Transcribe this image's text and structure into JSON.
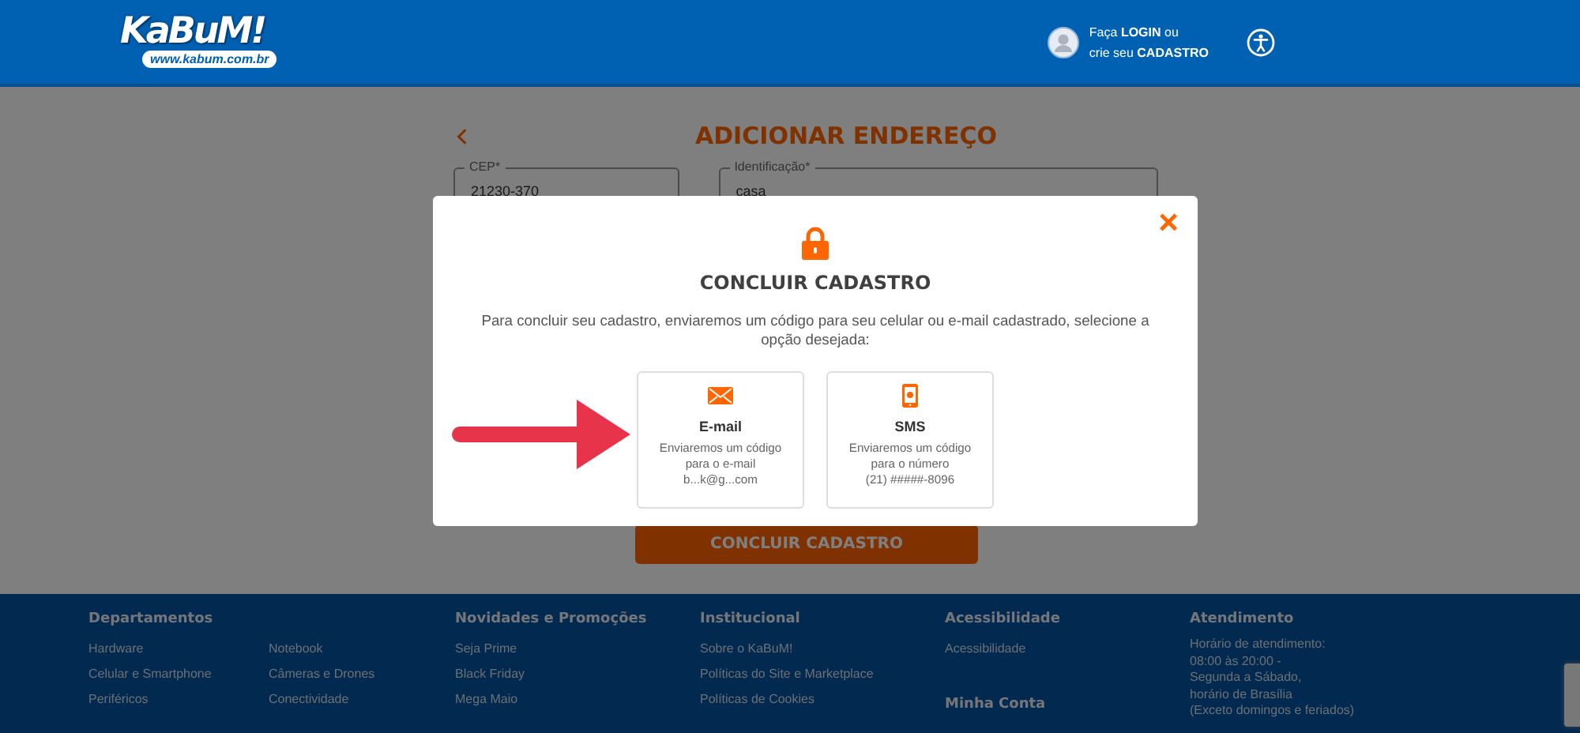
{
  "header": {
    "logo": "KaBuM!",
    "logo_url": "www.kabum.com.br",
    "login_text": [
      "Faça **LOGIN** ou",
      "crie seu **CADASTRO**"
    ]
  },
  "form": {
    "title": "ADICIONAR ENDEREÇO",
    "fields": [
      {
        "label": "CEP*",
        "value": "21230-370"
      },
      {
        "label": "Identificação*",
        "value": "casa"
      }
    ],
    "submit": "CONCLUIR CADASTRO"
  },
  "modal": {
    "title": "CONCLUIR CADASTRO",
    "close": "×",
    "description": "Para concluir seu cadastro, enviaremos um código para seu celular ou e-mail cadastrado, selecione a opção desejada:",
    "options": [
      {
        "kind": "email",
        "title": "E-mail",
        "text": [
          "Enviaremos um código",
          "para o e-mail",
          "b...k@g...com"
        ]
      },
      {
        "kind": "sms",
        "title": "SMS",
        "text": [
          "Enviaremos um código",
          "para o número",
          "(21) #####-8096"
        ]
      }
    ]
  },
  "footer": {
    "columns": [
      {
        "sections": [
          {
            "heading": "Departamentos",
            "lists": [
              [
                "Hardware",
                "Celular e Smartphone",
                "Periféricos"
              ],
              [
                "Notebook",
                "Câmeras e Drones",
                "Conectividade"
              ]
            ]
          }
        ]
      },
      {
        "sections": [
          {
            "heading": "Novidades e Promoções",
            "lists": [
              [
                "Seja Prime",
                "Black Friday",
                "Mega Maio"
              ]
            ]
          }
        ]
      },
      {
        "sections": [
          {
            "heading": "Institucional",
            "lists": [
              [
                "Sobre o KaBuM!",
                "Políticas do Site e Marketplace",
                "Políticas de Cookies"
              ]
            ]
          }
        ]
      },
      {
        "sections": [
          {
            "heading": "Acessibilidade",
            "lists": [
              [
                "Acessibilidade"
              ]
            ]
          },
          {
            "heading": "Minha Conta"
          }
        ]
      },
      {
        "sections": [
          {
            "heading": "Atendimento",
            "note": [
              "Horário de atendimento:",
              "08:00 às 20:00 -",
              "Segunda a Sábado,",
              "horário de Brasília",
              "(Exceto domingos e feriados)"
            ]
          }
        ]
      }
    ]
  }
}
